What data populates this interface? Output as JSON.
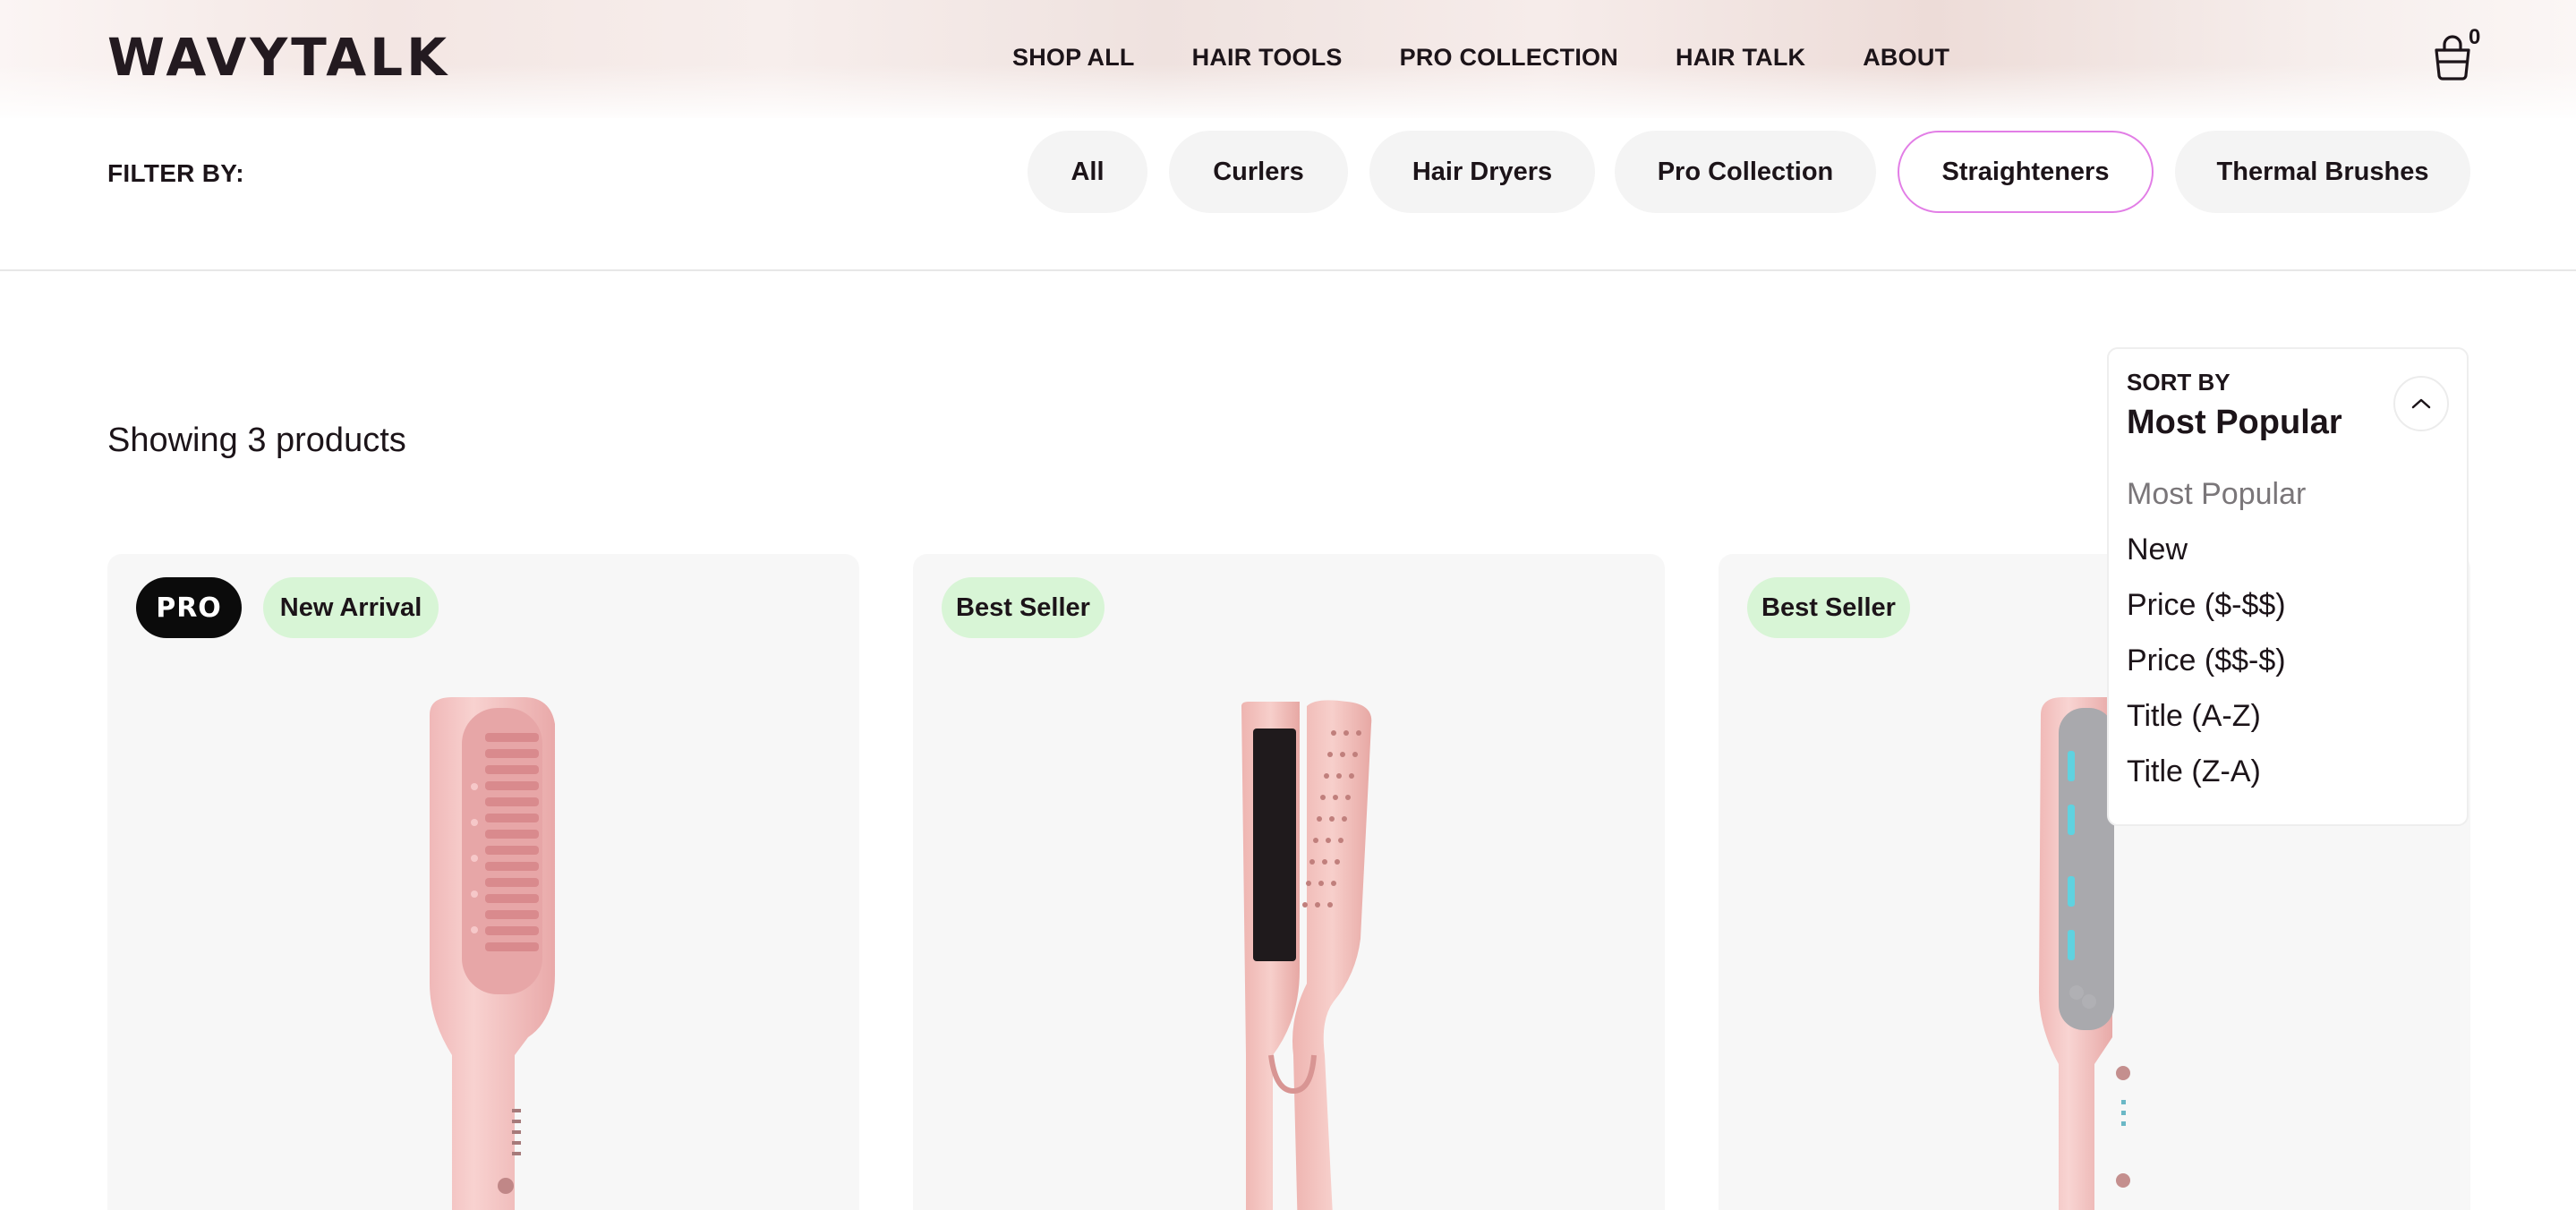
{
  "header": {
    "logo": "WAVYTALK",
    "nav": [
      "SHOP ALL",
      "HAIR TOOLS",
      "PRO COLLECTION",
      "HAIR TALK",
      "ABOUT"
    ],
    "cart_icon": "shopping-bag-icon",
    "cart_count": "0"
  },
  "filter": {
    "label": "FILTER BY:",
    "chips": [
      "All",
      "Curlers",
      "Hair Dryers",
      "Pro Collection",
      "Straighteners",
      "Thermal Brushes"
    ],
    "active": "Straighteners",
    "active_color": "#e27ee6"
  },
  "results": {
    "showing": "Showing 3 products"
  },
  "sort": {
    "label": "SORT BY",
    "value": "Most Popular",
    "toggle_icon": "chevron-up-icon",
    "options": [
      "Most Popular",
      "New",
      "Price ($-$$)",
      "Price ($$-$)",
      "Title (A-Z)",
      "Title (Z-A)"
    ]
  },
  "products": [
    {
      "badges": [
        "PRO",
        "New Arrival"
      ],
      "image": "pink-straightening-brush"
    },
    {
      "badges": [
        "Best Seller"
      ],
      "image": "pink-flat-iron"
    },
    {
      "badges": [
        "Best Seller"
      ],
      "image": "pink-ionic-straightening-brush"
    }
  ],
  "colors": {
    "badge_green": "#d8f5d6",
    "badge_pro": "#0b0b0b",
    "product_pink": "#f3c6c6"
  }
}
